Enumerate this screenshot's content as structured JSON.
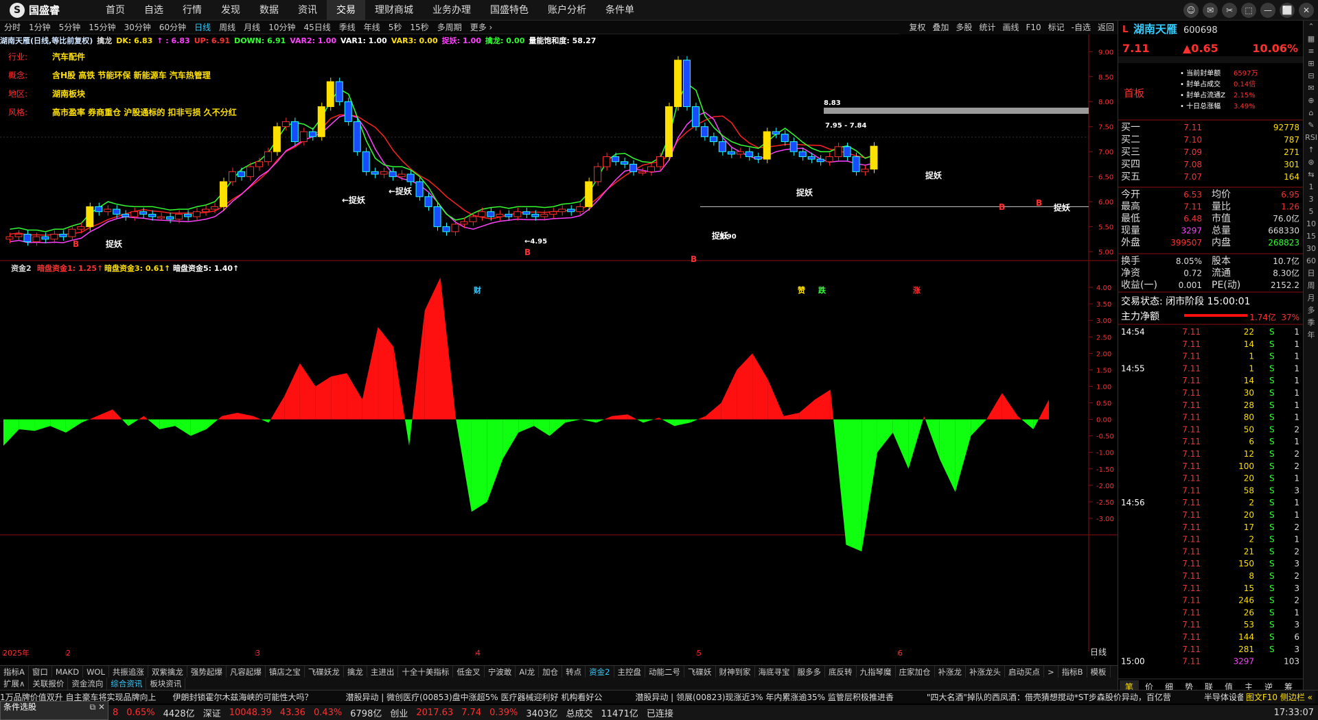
{
  "app": {
    "logo_text": "国盛睿",
    "logo_char": "S"
  },
  "menu": [
    "首页",
    "自选",
    "行情",
    "发现",
    "数据",
    "资讯",
    "交易",
    "理财商城",
    "业务办理",
    "国盛特色",
    "账户分析",
    "条件单"
  ],
  "menu_active": 6,
  "window_controls": [
    "☺",
    "✉",
    "✂",
    "⬚",
    "—",
    "⬜",
    "✕"
  ],
  "periods": [
    "分时",
    "1分钟",
    "5分钟",
    "15分钟",
    "30分钟",
    "60分钟",
    "日线",
    "周线",
    "月线",
    "10分钟",
    "45日线",
    "季线",
    "年线",
    "5秒",
    "15秒",
    "多周期",
    "更多 ›"
  ],
  "period_active": 6,
  "tools": [
    "复权",
    "叠加",
    "多股",
    "统计",
    "画线",
    "F10",
    "标记",
    "-自选",
    "返回"
  ],
  "indicator_line": [
    {
      "t": "湖南天雁(日线,等比前复权)",
      "c": "#cfe6ff"
    },
    {
      "t": "擒龙",
      "c": "#ddd"
    },
    {
      "t": "DK: 6.83",
      "c": "#ffe000"
    },
    {
      "t": "↑ : 6.83",
      "c": "#ff40ff"
    },
    {
      "t": "UP: 6.91",
      "c": "#ff3030"
    },
    {
      "t": "DOWN: 6.91",
      "c": "#30ff30"
    },
    {
      "t": "VAR2: 1.00",
      "c": "#ff40ff"
    },
    {
      "t": "VAR1: 1.00",
      "c": "#ffffff"
    },
    {
      "t": "VAR3: 0.00",
      "c": "#ffe000"
    },
    {
      "t": "捉妖: 1.00",
      "c": "#ff40ff"
    },
    {
      "t": "擒龙: 0.00",
      "c": "#30ff30"
    },
    {
      "t": "量能饱和度: 58.27",
      "c": "#ffffff"
    }
  ],
  "info": [
    {
      "k": "行业:",
      "v": "汽车配件"
    },
    {
      "k": "概念:",
      "v": "含H股 高铁 节能环保 新能源车 汽车热管理"
    },
    {
      "k": "地区:",
      "v": "湖南板块"
    },
    {
      "k": "风格:",
      "v": "高市盈率 券商重仓 沪股通标的 扣非亏损 久不分红"
    }
  ],
  "price_axis": [
    "9.00",
    "8.50",
    "8.00",
    "7.50",
    "7.00",
    "6.50",
    "6.00",
    "5.50",
    "5.00"
  ],
  "sub_indicator": [
    {
      "t": "资金2",
      "c": "#ddd"
    },
    {
      "t": "暗盘资金1: 1.25↑",
      "c": "#ff3030"
    },
    {
      "t": "暗盘资金3: 0.61↑",
      "c": "#ffe000"
    },
    {
      "t": "暗盘资金5: 1.40↑",
      "c": "#ffffff"
    }
  ],
  "sub_axis": [
    "4.00",
    "3.50",
    "3.00",
    "2.50",
    "2.00",
    "1.50",
    "1.00",
    "0.50",
    "0.00",
    "-0.50",
    "-1.00",
    "-1.50",
    "-2.00",
    "-2.50",
    "-3.00"
  ],
  "date_axis": [
    "2025年",
    "2",
    "3",
    "4",
    "5",
    "6"
  ],
  "period_label": "日线",
  "chart_marks": {
    "high": "8.83",
    "low": "←4.95",
    "range": "7.95 - 7.84",
    "zy": "←捉妖",
    "zy2": "捉妖",
    "b": "B",
    "cai": "财",
    "zu": "赞",
    "die": "跌",
    "zhang": "涨",
    "bao": "5.90"
  },
  "chart_data": {
    "type": "candlestick",
    "closes": [
      5.3,
      5.35,
      5.2,
      5.3,
      5.25,
      5.35,
      5.3,
      5.45,
      5.5,
      5.9,
      5.8,
      5.85,
      5.75,
      5.7,
      5.8,
      5.75,
      5.7,
      5.7,
      5.65,
      5.75,
      5.7,
      5.8,
      5.85,
      5.9,
      6.4,
      6.6,
      6.5,
      6.7,
      6.8,
      7.0,
      7.5,
      7.6,
      7.2,
      7.4,
      7.3,
      7.9,
      8.4,
      8.0,
      7.6,
      7.0,
      6.6,
      6.55,
      6.6,
      6.5,
      6.55,
      6.4,
      6.1,
      5.9,
      5.5,
      5.4,
      5.55,
      5.6,
      5.7,
      5.8,
      5.7,
      5.75,
      5.7,
      5.8,
      5.75,
      5.7,
      5.75,
      5.8,
      5.85,
      5.8,
      5.9,
      6.4,
      6.7,
      6.9,
      6.8,
      6.75,
      6.6,
      6.6,
      6.7,
      6.9,
      7.9,
      8.83,
      7.9,
      7.5,
      7.3,
      7.2,
      7.0,
      6.95,
      7.0,
      6.9,
      6.85,
      7.4,
      7.35,
      7.2,
      7.0,
      6.9,
      6.85,
      6.8,
      6.9,
      7.1,
      6.9,
      6.6,
      6.65,
      7.11
    ],
    "osc": [
      -0.8,
      -0.3,
      -0.35,
      -0.2,
      -0.4,
      -0.1,
      0.1,
      0.3,
      -0.2,
      0.1,
      -0.3,
      -0.2,
      -0.5,
      -0.3,
      0.1,
      0.2,
      0.1,
      -0.1,
      0.7,
      1.7,
      1.0,
      1.3,
      1.4,
      0.6,
      2.8,
      2.2,
      -0.8,
      3.3,
      4.3,
      0.0,
      -2.8,
      -2.5,
      -1.2,
      -0.4,
      -0.2,
      -0.5,
      -0.1,
      0.0,
      -0.1,
      0.1,
      0.15,
      -0.1,
      0.05,
      -0.2,
      -0.1,
      0.1,
      0.5,
      1.5,
      2.0,
      1.2,
      0.1,
      0.2,
      0.6,
      0.9,
      -3.8,
      -4.0,
      -1.0,
      -0.4,
      -1.5,
      0.1,
      -1.2,
      -2.2,
      -0.5,
      0.0,
      0.8,
      0.1,
      -0.3,
      0.6
    ]
  },
  "quote": {
    "name": "湖南天雁",
    "code": "600698",
    "flag": "L",
    "price": "7.11",
    "change": "▲0.65",
    "pct": "10.06%",
    "first_board": "首板",
    "seal_rows": [
      {
        "k": "当前封单额",
        "v": "6597万"
      },
      {
        "k": "封单占成交",
        "v": "0.14倍"
      },
      {
        "k": "封单占流通Z",
        "v": "2.15%"
      },
      {
        "k": "十日总涨幅",
        "v": "3.49%"
      }
    ],
    "book": [
      {
        "k": "买一",
        "p": "7.11",
        "v": "92778"
      },
      {
        "k": "买二",
        "p": "7.10",
        "v": "787"
      },
      {
        "k": "买三",
        "p": "7.09",
        "v": "271"
      },
      {
        "k": "买四",
        "p": "7.08",
        "v": "301"
      },
      {
        "k": "买五",
        "p": "7.07",
        "v": "164"
      }
    ],
    "stats": [
      {
        "k1": "今开",
        "v1": "6.53",
        "k2": "均价",
        "v2": "6.95"
      },
      {
        "k1": "最高",
        "v1": "7.11",
        "k2": "量比",
        "v2": "1.26"
      },
      {
        "k1": "最低",
        "v1": "6.48",
        "k2": "市值",
        "v2": "76.0亿"
      },
      {
        "k1": "现量",
        "v1": "3297",
        "k2": "总量",
        "v2": "668330"
      },
      {
        "k1": "外盘",
        "v1": "399507",
        "k2": "内盘",
        "v2": "268823"
      }
    ],
    "stats2": [
      {
        "k1": "换手",
        "v1": "8.05%",
        "k2": "股本",
        "v2": "10.7亿"
      },
      {
        "k1": "净资",
        "v1": "0.72",
        "k2": "流通",
        "v2": "8.30亿"
      },
      {
        "k1": "收益(一)",
        "v1": "0.001",
        "k2": "PE(动)",
        "v2": "2152.2"
      }
    ],
    "trade_status": "交易状态: 闭市阶段 15:00:01",
    "main_net_label": "主力净额",
    "main_net": "1.74亿",
    "main_pct": "37%",
    "ticks": [
      {
        "t": "14:54",
        "p": "7.11",
        "v": "22",
        "d": "S",
        "n": "1"
      },
      {
        "t": "",
        "p": "7.11",
        "v": "14",
        "d": "S",
        "n": "1"
      },
      {
        "t": "",
        "p": "7.11",
        "v": "1",
        "d": "S",
        "n": "1"
      },
      {
        "t": "14:55",
        "p": "7.11",
        "v": "1",
        "d": "S",
        "n": "1"
      },
      {
        "t": "",
        "p": "7.11",
        "v": "14",
        "d": "S",
        "n": "1"
      },
      {
        "t": "",
        "p": "7.11",
        "v": "30",
        "d": "S",
        "n": "1"
      },
      {
        "t": "",
        "p": "7.11",
        "v": "28",
        "d": "S",
        "n": "1"
      },
      {
        "t": "",
        "p": "7.11",
        "v": "80",
        "d": "S",
        "n": "1"
      },
      {
        "t": "",
        "p": "7.11",
        "v": "50",
        "d": "S",
        "n": "2"
      },
      {
        "t": "",
        "p": "7.11",
        "v": "6",
        "d": "S",
        "n": "1"
      },
      {
        "t": "",
        "p": "7.11",
        "v": "12",
        "d": "S",
        "n": "2"
      },
      {
        "t": "",
        "p": "7.11",
        "v": "100",
        "d": "S",
        "n": "2"
      },
      {
        "t": "",
        "p": "7.11",
        "v": "20",
        "d": "S",
        "n": "1"
      },
      {
        "t": "",
        "p": "7.11",
        "v": "58",
        "d": "S",
        "n": "3"
      },
      {
        "t": "14:56",
        "p": "7.11",
        "v": "2",
        "d": "S",
        "n": "1"
      },
      {
        "t": "",
        "p": "7.11",
        "v": "20",
        "d": "S",
        "n": "1"
      },
      {
        "t": "",
        "p": "7.11",
        "v": "17",
        "d": "S",
        "n": "2"
      },
      {
        "t": "",
        "p": "7.11",
        "v": "2",
        "d": "S",
        "n": "1"
      },
      {
        "t": "",
        "p": "7.11",
        "v": "21",
        "d": "S",
        "n": "2"
      },
      {
        "t": "",
        "p": "7.11",
        "v": "150",
        "d": "S",
        "n": "3"
      },
      {
        "t": "",
        "p": "7.11",
        "v": "8",
        "d": "S",
        "n": "2"
      },
      {
        "t": "",
        "p": "7.11",
        "v": "15",
        "d": "S",
        "n": "3"
      },
      {
        "t": "",
        "p": "7.11",
        "v": "246",
        "d": "S",
        "n": "2"
      },
      {
        "t": "",
        "p": "7.11",
        "v": "26",
        "d": "S",
        "n": "1"
      },
      {
        "t": "",
        "p": "7.11",
        "v": "53",
        "d": "S",
        "n": "3"
      },
      {
        "t": "",
        "p": "7.11",
        "v": "144",
        "d": "S",
        "n": "6"
      },
      {
        "t": "",
        "p": "7.11",
        "v": "281",
        "d": "S",
        "n": "3"
      },
      {
        "t": "15:00",
        "p": "7.11",
        "v": "3297",
        "d": "",
        "n": "103"
      }
    ],
    "bottom_tabs": [
      "笔",
      "价",
      "细",
      "势",
      "联",
      "值",
      "主",
      "逆",
      "筹"
    ]
  },
  "right_sidebar": [
    "⌃",
    "▦",
    "≡",
    "⊞",
    "⊟",
    "✉",
    "⊕",
    "⌂",
    "✎",
    "RSI",
    "↑",
    "⊛",
    "⇆",
    "1",
    "3",
    "5",
    "10",
    "15",
    "30",
    "60",
    "日",
    "周",
    "月",
    "多",
    "季",
    "年"
  ],
  "bottom_tabs": [
    "指标A",
    "窗口",
    "MAKD",
    "WOL",
    "共振追涨",
    "双紫擒龙",
    "强势起爆",
    "凡容起爆",
    "镇店之宝",
    "飞碟妖龙",
    "擒龙",
    "主进出",
    "十全十美指标",
    "低金叉",
    "宁波敢",
    "AI龙",
    "加仓",
    "转点",
    "资金2",
    "主控盘",
    "动能二号",
    "飞碟妖",
    "财神到家",
    "海底寻宝",
    "服多多",
    "底反转",
    "九指琴魔",
    "庄家加仓",
    "补涨龙",
    "补涨龙头",
    "启动买点",
    ">",
    "指标B",
    "模板"
  ],
  "bottom_tabs_active": 18,
  "bottom_tabs2": [
    "扩展∧",
    "关联报价",
    "资金流向",
    "综合资讯",
    "板块资讯"
  ],
  "bottom_tabs2_active": 3,
  "news": "1万品牌价值双升 自主豪车将实现品牌向上　　伊朗封锁霍尔木兹海峡的可能性大吗？　　　　潜股异动 | 微创医疗(00853)盘中涨超5% 医疗器械迎利好 机构看好公　　　　潜股异动 | 领展(00823)现涨近3% 年内累涨逾35% 监管层积极推进香　　　　\"四大名酒\"掉队的西凤酒：借壳猜想搅动*ST步森股价异动，百亿营　　　　半导体设备板块拉升，中晶",
  "news_right_tab": "图文F10 侧边栏 «",
  "status": [
    {
      "t": "8",
      "c": "#ff3030"
    },
    {
      "t": "0.65%",
      "c": "#ff3030"
    },
    {
      "t": "4428亿",
      "c": "#ddd"
    },
    {
      "t": "深证",
      "c": "#ddd"
    },
    {
      "t": "10048.39",
      "c": "#ff3030"
    },
    {
      "t": "43.36",
      "c": "#ff3030"
    },
    {
      "t": "0.43%",
      "c": "#ff3030"
    },
    {
      "t": "6798亿",
      "c": "#ddd"
    },
    {
      "t": "创业",
      "c": "#ddd"
    },
    {
      "t": "2017.63",
      "c": "#ff3030"
    },
    {
      "t": "7.74",
      "c": "#ff3030"
    },
    {
      "t": "0.39%",
      "c": "#ff3030"
    },
    {
      "t": "3403亿",
      "c": "#ddd"
    },
    {
      "t": "总成交",
      "c": "#ddd"
    },
    {
      "t": "11471亿",
      "c": "#ddd"
    },
    {
      "t": "已连接",
      "c": "#ddd"
    }
  ],
  "clock": "17:33:07",
  "cond_window": {
    "title": "条件选股",
    "ctl": "⧉ ✕"
  }
}
